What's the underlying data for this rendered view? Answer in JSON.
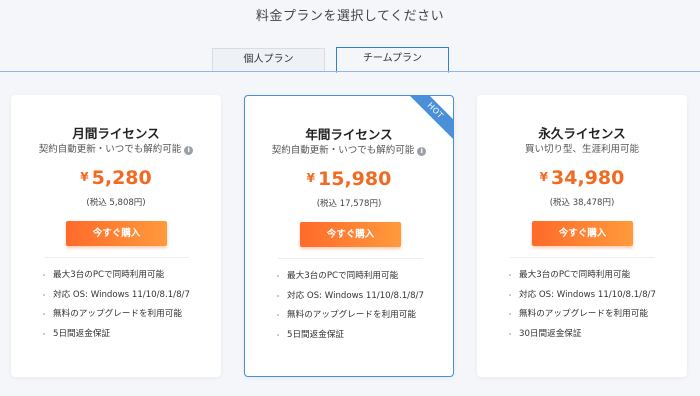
{
  "page": {
    "title": "料金プランを選択してください"
  },
  "tabs": [
    {
      "label": "個人プラン"
    },
    {
      "label": "チームプラン"
    }
  ],
  "colors": {
    "accent": "#f26a22",
    "active_tab": "#2f80d1",
    "hot_badge": "#4a90d9"
  },
  "plans": [
    {
      "title": "月間ライセンス",
      "subtitle": "契約自動更新・いつでも解約可能",
      "info_icon": "i",
      "currency": "¥",
      "price": "5,280",
      "price_tax": "(税込 5,808円)",
      "buy_label": "今すぐ購入",
      "features": [
        "最大3台のPCで同時利用可能",
        "対応 OS: Windows 11/10/8.1/8/7",
        "無料のアップグレードを利用可能",
        "5日間返金保証"
      ]
    },
    {
      "title": "年間ライセンス",
      "subtitle": "契約自動更新・いつでも解約可能",
      "info_icon": "i",
      "badge": "HOT",
      "currency": "¥",
      "price": "15,980",
      "price_tax": "(税込 17,578円)",
      "buy_label": "今すぐ購入",
      "features": [
        "最大3台のPCで同時利用可能",
        "対応 OS: Windows 11/10/8.1/8/7",
        "無料のアップグレードを利用可能",
        "5日間返金保証"
      ]
    },
    {
      "title": "永久ライセンス",
      "subtitle": "買い切り型、生涯利用可能",
      "currency": "¥",
      "price": "34,980",
      "price_tax": "(税込 38,478円)",
      "buy_label": "今すぐ購入",
      "features": [
        "最大3台のPCで同時利用可能",
        "対応 OS: Windows 11/10/8.1/8/7",
        "無料のアップグレードを利用可能",
        "30日間返金保証"
      ]
    }
  ]
}
